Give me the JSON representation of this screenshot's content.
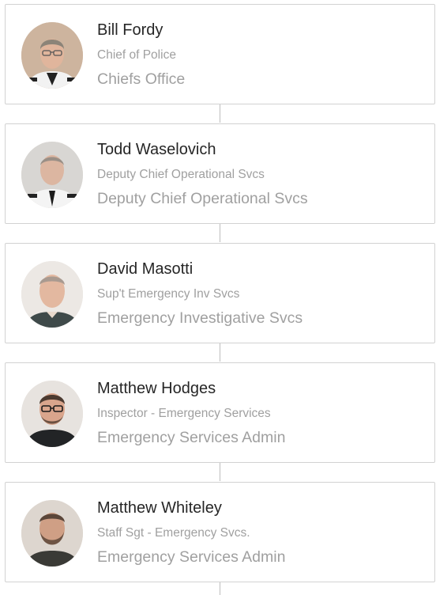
{
  "people": [
    {
      "name": "Bill Fordy",
      "title": "Chief of Police",
      "department": "Chiefs Office",
      "photo": "bill-fordy-photo"
    },
    {
      "name": "Todd Waselovich",
      "title": "Deputy Chief Operational Svcs",
      "department": "Deputy Chief Operational Svcs",
      "photo": "todd-waselovich-photo"
    },
    {
      "name": "David Masotti",
      "title": "Sup't Emergency Inv Svcs",
      "department": "Emergency Investigative Svcs",
      "photo": "david-masotti-photo"
    },
    {
      "name": "Matthew Hodges",
      "title": "Inspector - Emergency Services",
      "department": "Emergency Services Admin",
      "photo": "matthew-hodges-photo"
    },
    {
      "name": "Matthew Whiteley",
      "title": "Staff Sgt - Emergency Svcs.",
      "department": "Emergency Services Admin",
      "photo": "matthew-whiteley-photo"
    }
  ],
  "colors": {
    "card_border": "#d2d2d2",
    "name_text": "#262626",
    "secondary_text": "#a0a0a0",
    "connector": "#bdbdbd"
  }
}
